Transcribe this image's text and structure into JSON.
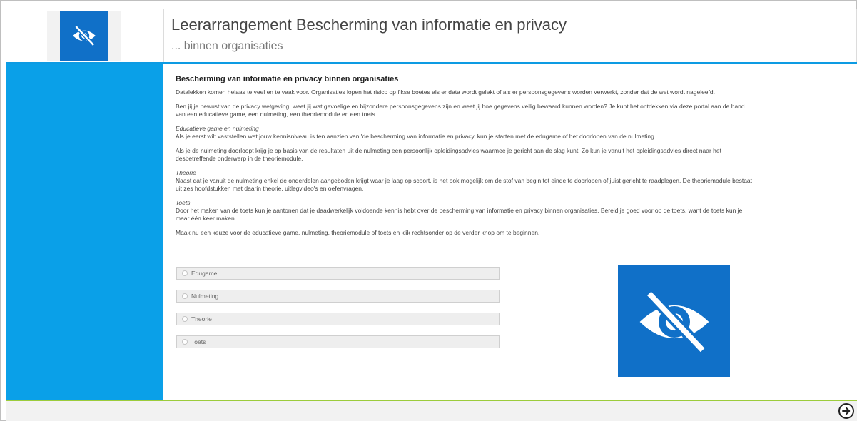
{
  "header": {
    "title": "Leerarrangement Bescherming van informatie en privacy",
    "subtitle": "... binnen organisaties",
    "logo_icon": "eye-slash-icon"
  },
  "content": {
    "heading": "Bescherming van informatie en privacy binnen organisaties",
    "intro": "Datalekken komen helaas te veel en te vaak voor. Organisaties lopen het risico op fikse boetes als er data wordt gelekt of als er persoonsgegevens worden verwerkt, zonder dat de wet wordt nageleefd.",
    "p2": "Ben jij je bewust van de privacy wetgeving, weet jij wat gevoelige en bijzondere persoonsgegevens zijn en weet jij hoe gegevens veilig bewaard kunnen worden? Je kunt het ontdekken via deze portal aan de hand van een educatieve game, een nulmeting, een theoriemodule en een toets.",
    "edugame_heading": "Educatieve game en nulmeting",
    "edugame_text": "Als je eerst wilt vaststellen wat jouw kennisniveau is ten aanzien van 'de bescherming van informatie en privacy' kun je starten met de edugame of het doorlopen van de nulmeting.",
    "p4": "Als je de nulmeting doorloopt krijg je op basis van de resultaten uit de nulmeting een persoonlijk opleidingsadvies waarmee je gericht aan de slag kunt. Zo kun je vanuit het opleidingsadvies direct naar het desbetreffende onderwerp in de theoriemodule.",
    "theorie_heading": "Theorie",
    "theorie_text": "Naast dat je vanuit de nulmeting enkel de onderdelen aangeboden krijgt waar je laag op scoort, is het ook mogelijk om de stof van begin tot einde te doorlopen of juist gericht te raadplegen. De theoriemodule bestaat uit zes hoofdstukken met daarin theorie, uitlegvideo's en oefenvragen.",
    "toets_heading": "Toets",
    "toets_text": "Door het maken van de toets kun je aantonen dat je daadwerkelijk voldoende kennis hebt over de bescherming van informatie en privacy binnen organisaties. Bereid je goed voor op de toets, want de toets kun je maar één keer maken.",
    "instruction": "Maak nu een keuze voor de educatieve game, nulmeting, theoriemodule of toets en klik rechtsonder op de verder knop om te beginnen."
  },
  "options": [
    {
      "label": "Edugame"
    },
    {
      "label": "Nulmeting"
    },
    {
      "label": "Theorie"
    },
    {
      "label": "Toets"
    }
  ],
  "colors": {
    "brand_blue": "#1070c8",
    "sidebar_blue": "#0aa0e8",
    "accent_green": "#9ccc3c"
  },
  "footer": {
    "next_icon": "arrow-right-circle-icon"
  }
}
